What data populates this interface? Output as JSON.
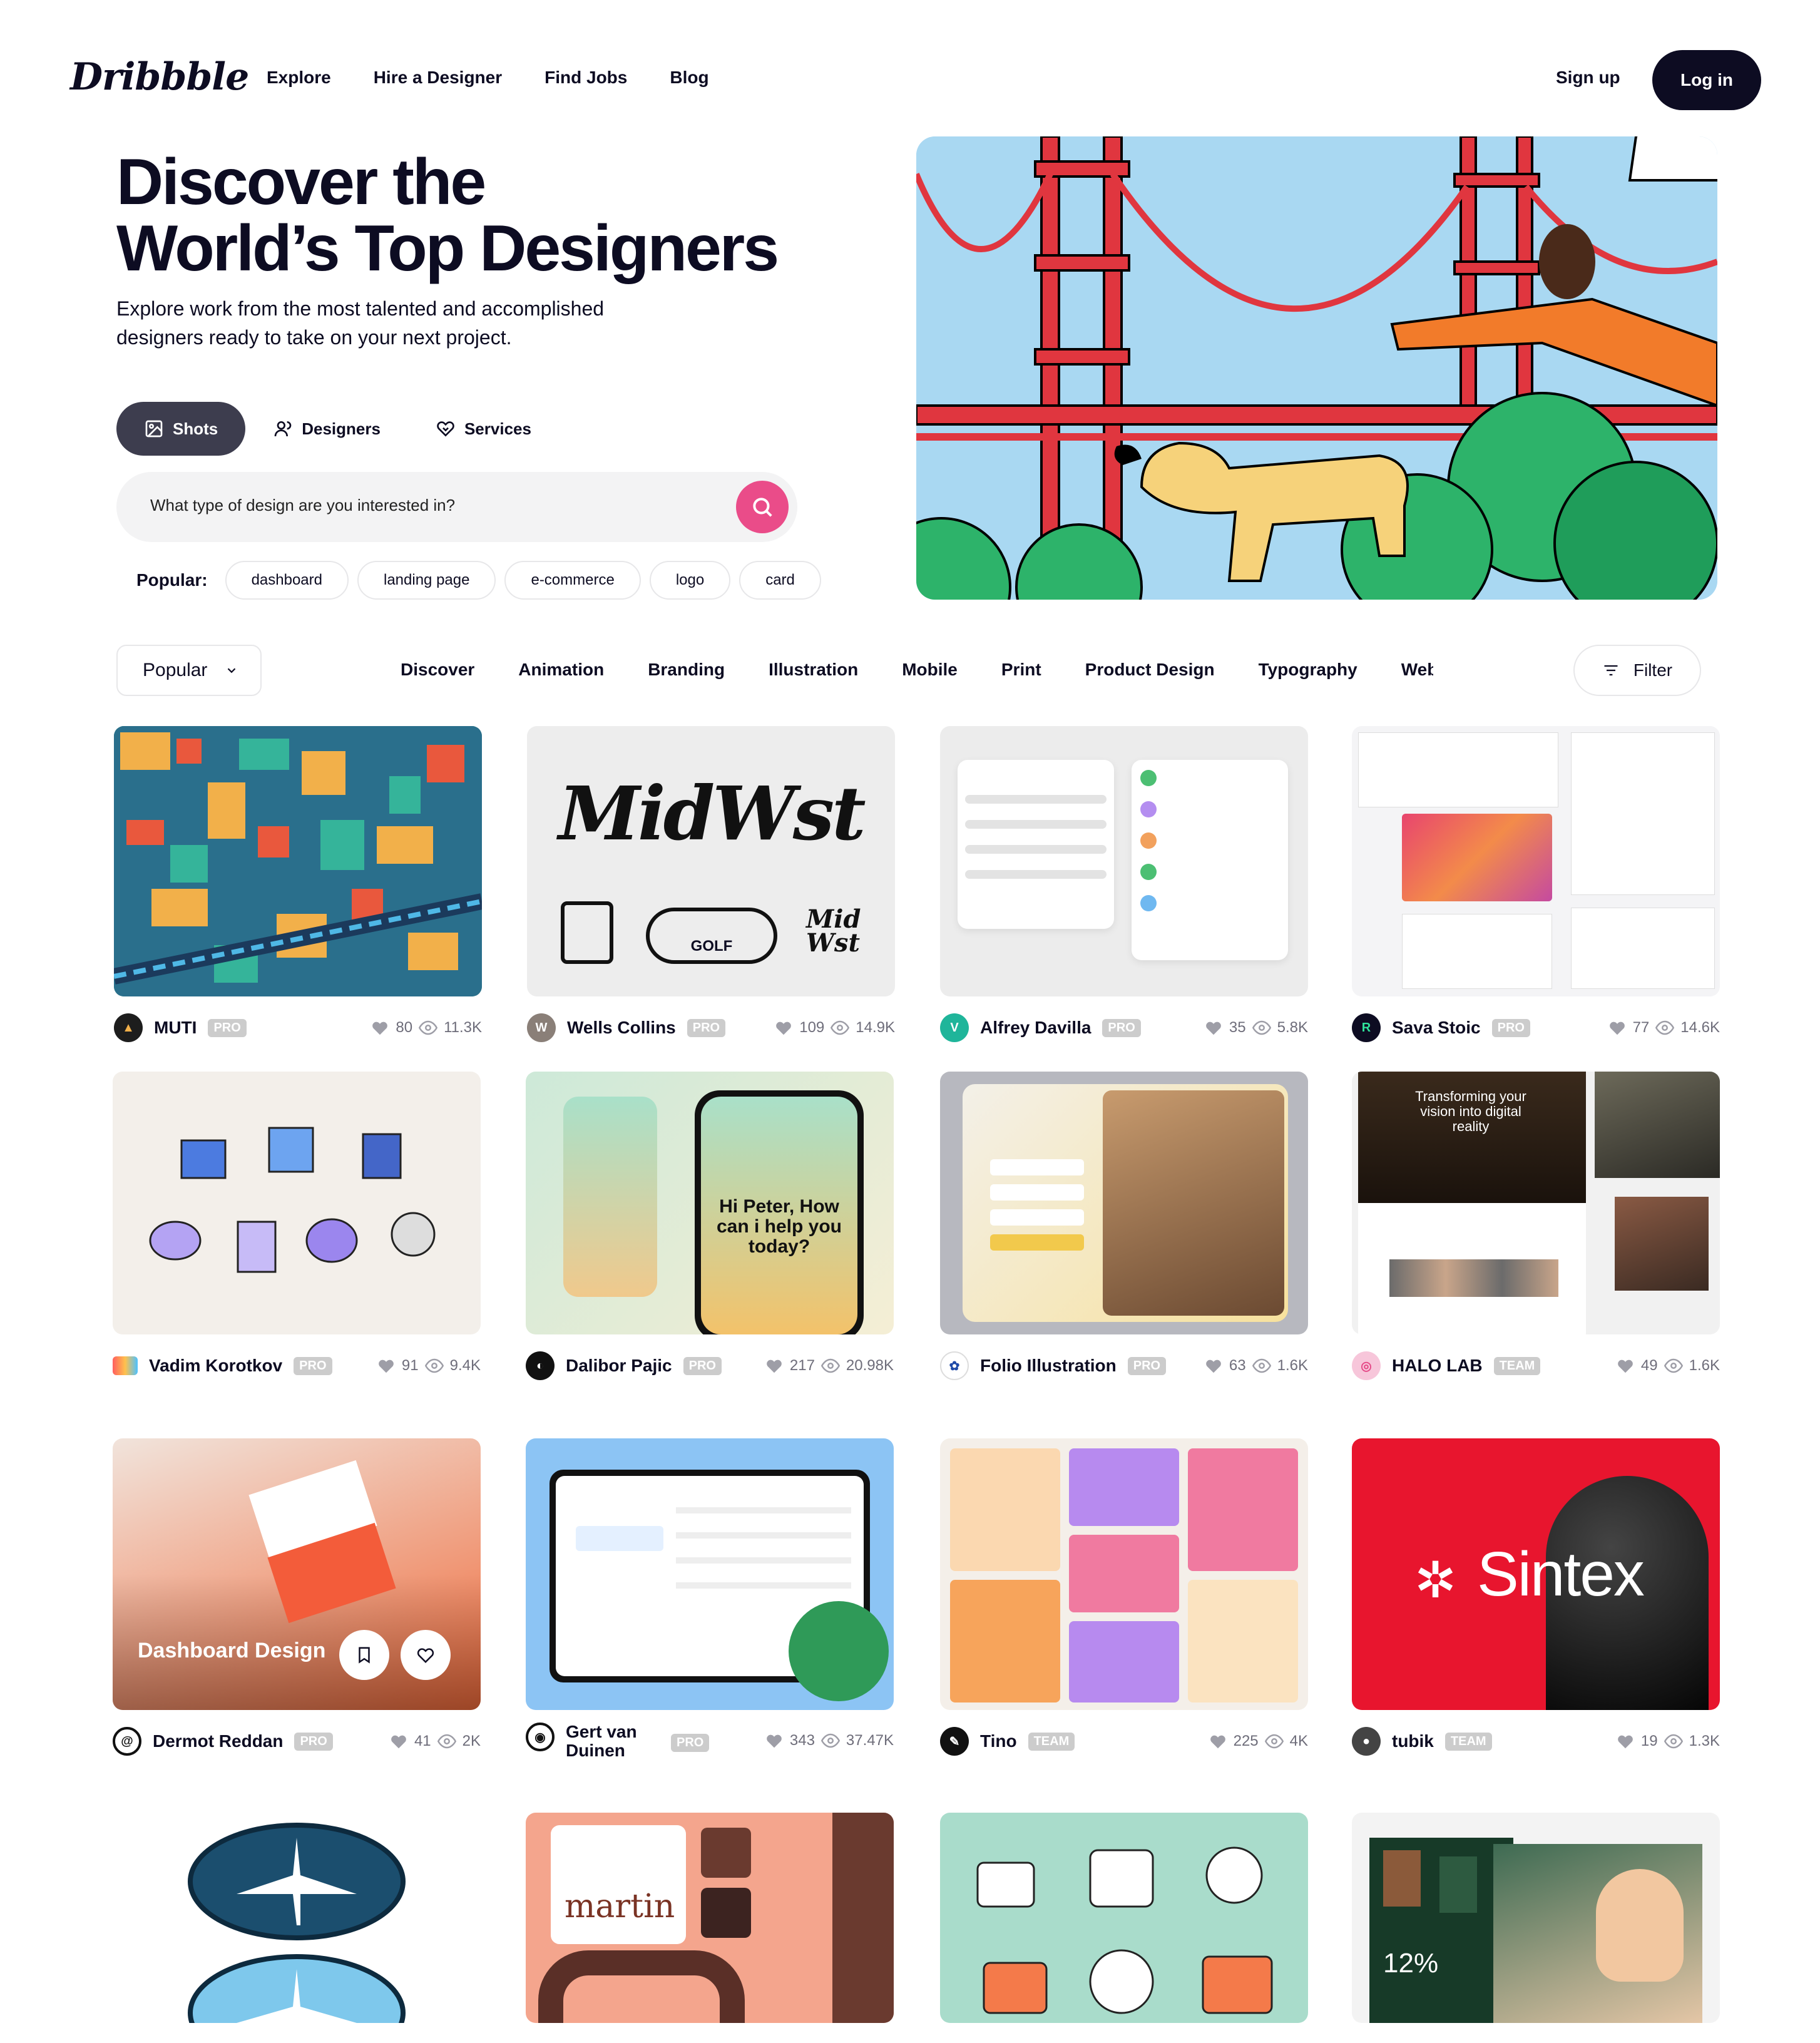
{
  "nav": {
    "logo": "Dribbble",
    "links": [
      "Explore",
      "Hire a Designer",
      "Find Jobs",
      "Blog"
    ],
    "signup": "Sign up",
    "login": "Log in"
  },
  "hero": {
    "title_line1": "Discover the",
    "title_line2": "World’s Top Designers",
    "subtitle_line1": "Explore work from the most talented and accomplished",
    "subtitle_line2": "designers ready to take on your next project.",
    "tabs": [
      {
        "label": "Shots",
        "icon": "image-icon"
      },
      {
        "label": "Designers",
        "icon": "user-icon"
      },
      {
        "label": "Services",
        "icon": "handshake-icon"
      }
    ],
    "search_placeholder": "What type of design are you interested in?",
    "popular_label": "Popular:",
    "popular": [
      "dashboard",
      "landing page",
      "e-commerce",
      "logo",
      "card"
    ]
  },
  "filters": {
    "sort": "Popular",
    "categories": [
      "Discover",
      "Animation",
      "Branding",
      "Illustration",
      "Mobile",
      "Print",
      "Product Design",
      "Typography",
      "Web Des"
    ],
    "filter_label": "Filter"
  },
  "colors": {
    "brand_pink": "#ea4c89",
    "dark": "#0d0c22",
    "login_bg": "#0d0c22"
  },
  "shots": [
    {
      "user": "MUTI",
      "badge": "PRO",
      "likes": "80",
      "views": "11.3K"
    },
    {
      "user": "Wells Collins",
      "badge": "PRO",
      "likes": "109",
      "views": "14.9K",
      "art_text": "MidWst",
      "art_sub": "GOLF"
    },
    {
      "user": "Alfrey Davilla",
      "badge": "PRO",
      "likes": "35",
      "views": "5.8K"
    },
    {
      "user": "Sava Stoic",
      "badge": "PRO",
      "likes": "77",
      "views": "14.6K"
    },
    {
      "user": "Vadim Korotkov",
      "badge": "PRO",
      "likes": "91",
      "views": "9.4K"
    },
    {
      "user": "Dalibor Pajic",
      "badge": "PRO",
      "likes": "217",
      "views": "20.98K",
      "art_text": "Hi Peter, How can i help you today?"
    },
    {
      "user": "Folio Illustration",
      "badge": "PRO",
      "likes": "63",
      "views": "1.6K"
    },
    {
      "user": "HALO LAB",
      "badge": "TEAM",
      "likes": "49",
      "views": "1.6K",
      "art_text": "Transforming your vision into digital reality"
    },
    {
      "user": "Dermot Reddan",
      "badge": "PRO",
      "likes": "41",
      "views": "2K",
      "overlay_title": "Dashboard Design"
    },
    {
      "user": "Gert van Duinen",
      "badge": "PRO",
      "likes": "343",
      "views": "37.47K"
    },
    {
      "user": "Tino",
      "badge": "TEAM",
      "likes": "225",
      "views": "4K"
    },
    {
      "user": "tubik",
      "badge": "TEAM",
      "likes": "19",
      "views": "1.3K",
      "art_text": "Sintex"
    },
    {
      "art": "plane-badges"
    },
    {
      "art": "martin",
      "art_text": "martin"
    },
    {
      "art": "illustrations"
    },
    {
      "art": "forma",
      "art_text": "12%"
    }
  ]
}
